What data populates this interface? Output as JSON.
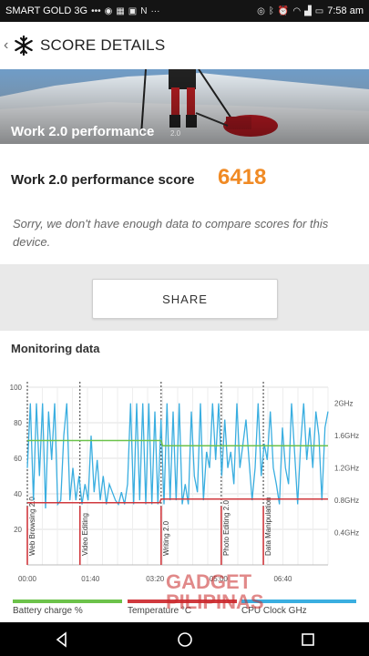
{
  "status_bar": {
    "carrier": "SMART GOLD 3G",
    "time": "7:58 am",
    "left_icons": [
      "dots-icon",
      "messenger-icon",
      "grid-icon",
      "image-icon",
      "n-icon",
      "more-icon"
    ],
    "right_icons": [
      "signal-icon",
      "bluetooth-icon",
      "alarm-icon",
      "wifi-icon",
      "cell-icon",
      "battery-icon"
    ]
  },
  "app_bar": {
    "title": "SCORE DETAILS",
    "back_icon": "chevron-left-icon",
    "logo_icon": "snowflake-logo-icon"
  },
  "hero": {
    "label": "Work 2.0 performance",
    "version": "2.0"
  },
  "score": {
    "label": "Work 2.0 performance score",
    "value": "6418"
  },
  "notice": "Sorry, we don't have enough data to compare scores for this device.",
  "share_label": "SHARE",
  "monitoring": {
    "title": "Monitoring data"
  },
  "chart_data": {
    "type": "line",
    "x_ticks": [
      "00:00",
      "01:40",
      "03:20",
      "05:00",
      "06:40"
    ],
    "y_left_ticks": [
      "100",
      "80",
      "60",
      "40",
      "20"
    ],
    "y_right_ticks": [
      "2GHz",
      "1.6GHz",
      "1.2GHz",
      "0.8GHz",
      "0.4GHz"
    ],
    "ylim_left": [
      0,
      100
    ],
    "ylim_right_ghz": [
      0,
      2.2
    ],
    "grid": true,
    "phase_markers": [
      {
        "label": "Web Browsing 2.0",
        "t": 0.0
      },
      {
        "label": "Video Editing",
        "t": 0.175
      },
      {
        "label": "Writing 2.0",
        "t": 0.445
      },
      {
        "label": "Photo Editing 2.0",
        "t": 0.645
      },
      {
        "label": "Data Manipulation",
        "t": 0.785
      }
    ],
    "series": [
      {
        "name": "Battery charge %",
        "color": "#6cc24a",
        "values_t": [
          0.0,
          0.445,
          0.45,
          1.0
        ],
        "values": [
          70,
          70,
          67,
          67
        ]
      },
      {
        "name": "Temperature °C",
        "color": "#d0393e",
        "values_t": [
          0.0,
          0.44,
          0.445,
          1.0
        ],
        "values": [
          35,
          35,
          37,
          37
        ]
      },
      {
        "name": "CPU Clock GHz",
        "color": "#3aaee0",
        "values": [
          1.2,
          2.0,
          0.8,
          2.0,
          1.1,
          2.0,
          0.7,
          1.9,
          1.3,
          2.0,
          0.75,
          0.8,
          1.6,
          2.0,
          0.8,
          1.2,
          0.8,
          1.1,
          0.75,
          1.0,
          0.8,
          1.6,
          0.9,
          1.3,
          0.8,
          1.1,
          0.75,
          1.0,
          0.9,
          0.8,
          0.75,
          0.9,
          0.75,
          1.0,
          2.0,
          0.75,
          2.0,
          0.8,
          2.0,
          0.75,
          2.0,
          0.75,
          1.9,
          0.75,
          1.8,
          0.75,
          2.0,
          0.8,
          1.9,
          0.8,
          2.0,
          0.75,
          1.0,
          0.75,
          1.9,
          1.1,
          0.9,
          2.0,
          0.8,
          1.4,
          1.2,
          2.0,
          1.3,
          2.0,
          1.1,
          1.8,
          1.2,
          1.4,
          1.0,
          2.0,
          1.2,
          1.5,
          1.8,
          1.3,
          0.8,
          1.2,
          2.0,
          1.1,
          1.5,
          1.3,
          1.9,
          1.2,
          1.0,
          0.75,
          1.7,
          1.2,
          1.0,
          2.0,
          1.4,
          0.75,
          1.5,
          2.0,
          1.3,
          1.7,
          1.2,
          1.9,
          1.6,
          0.8,
          1.7,
          1.9
        ]
      }
    ]
  },
  "legend": [
    "Battery charge %",
    "Temperature °C",
    "CPU Clock GHz"
  ],
  "watermark": {
    "line1": "GADGET",
    "line2": "PILIPINAS"
  },
  "nav": {
    "back_icon": "triangle-back-icon",
    "home_icon": "circle-home-icon",
    "recents_icon": "square-recents-icon"
  }
}
